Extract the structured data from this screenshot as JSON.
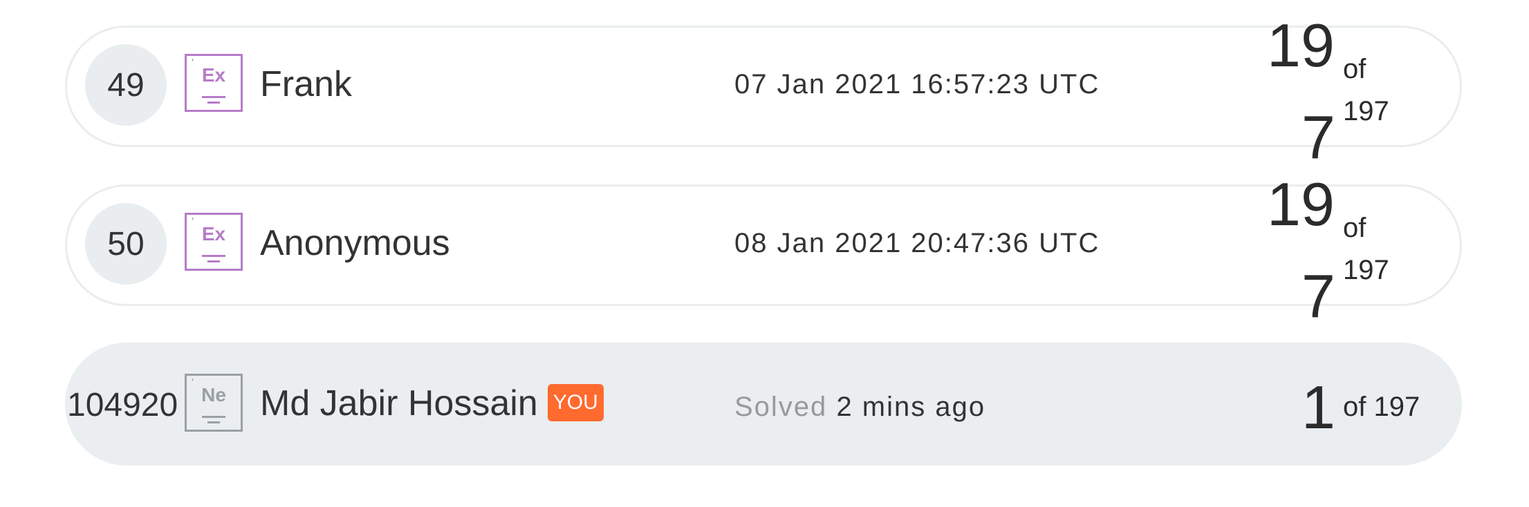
{
  "rows": [
    {
      "rank": "49",
      "badge": {
        "symbol": "Ex",
        "icon": "expert-badge-icon",
        "color": "#b67cc9"
      },
      "name": "Frank",
      "time": "07 Jan 2021 16:57:23 UTC",
      "score": {
        "solved_part1": "19",
        "of": "of",
        "solved_part2": "7",
        "total": "197"
      }
    },
    {
      "rank": "50",
      "badge": {
        "symbol": "Ex",
        "icon": "expert-badge-icon",
        "color": "#b67cc9"
      },
      "name": "Anonymous",
      "time": "08 Jan 2021 20:47:36 UTC",
      "score": {
        "solved_part1": "19",
        "of": "of",
        "solved_part2": "7",
        "total": "197"
      }
    },
    {
      "rank": "104920",
      "badge": {
        "symbol": "Ne",
        "icon": "neophyte-badge-icon",
        "color": "#9aa0a4"
      },
      "name": "Md Jabir Hossain",
      "you_label": "YOU",
      "solved_prefix": "Solved",
      "time": "2 mins ago",
      "score": {
        "solved": "1",
        "of_total": "of 197"
      }
    }
  ],
  "colors": {
    "row_border": "#e9edef",
    "highlight_row": "#eaeef0",
    "you_badge": "#ff6a2f"
  }
}
